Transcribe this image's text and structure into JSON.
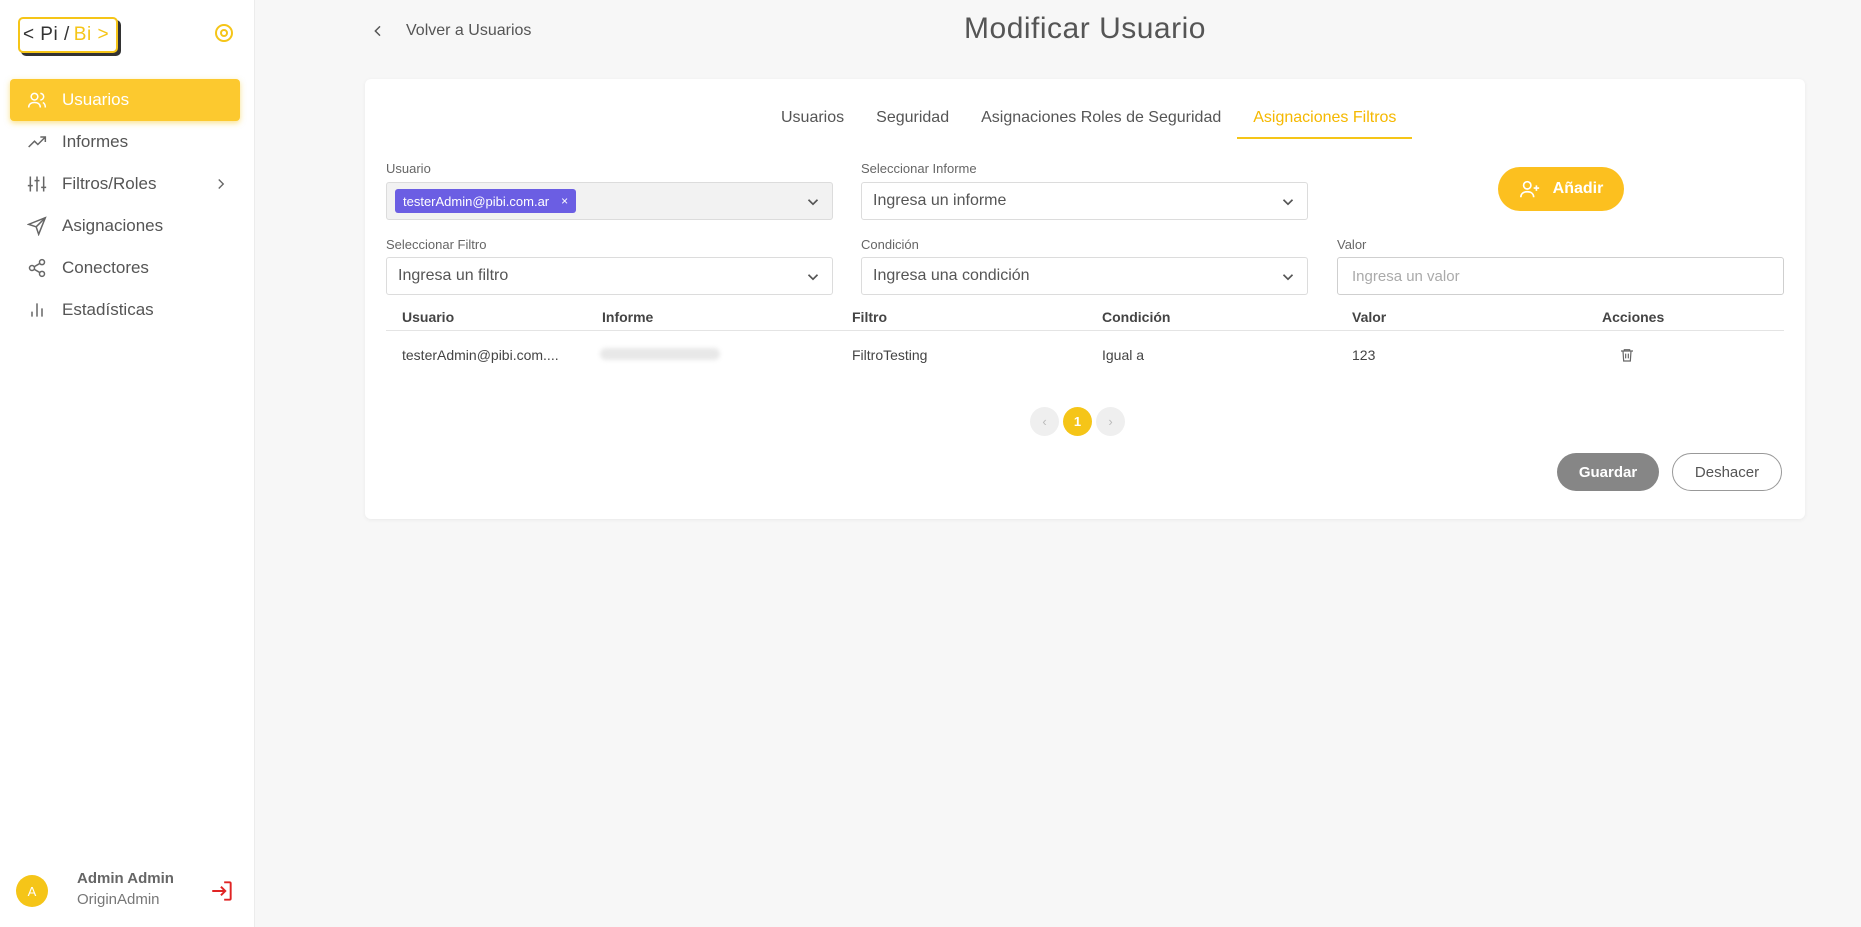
{
  "brand": {
    "logo_left": "< Pi /",
    "logo_right": "Bi >"
  },
  "sidebar": {
    "items": [
      {
        "label": "Usuarios",
        "icon": "users-icon",
        "active": true
      },
      {
        "label": "Informes",
        "icon": "trending-up-icon"
      },
      {
        "label": "Filtros/Roles",
        "icon": "sliders-icon",
        "has_submenu": true
      },
      {
        "label": "Asignaciones",
        "icon": "send-icon"
      },
      {
        "label": "Conectores",
        "icon": "share-icon"
      },
      {
        "label": "Estadísticas",
        "icon": "bar-chart-icon"
      }
    ]
  },
  "profile": {
    "initial": "A",
    "name": "Admin Admin",
    "role": "OriginAdmin"
  },
  "header": {
    "back_label": "Volver a Usuarios",
    "title": "Modificar Usuario"
  },
  "tabs": [
    "Usuarios",
    "Seguridad",
    "Asignaciones Roles de Seguridad",
    "Asignaciones Filtros"
  ],
  "active_tab": "Asignaciones Filtros",
  "form": {
    "usuario_label": "Usuario",
    "usuario_chip": "testerAdmin@pibi.com.ar",
    "chip_remove": "×",
    "informe_label": "Seleccionar Informe",
    "informe_placeholder": "Ingresa un informe",
    "filtro_label": "Seleccionar Filtro",
    "filtro_placeholder": "Ingresa un filtro",
    "condicion_label": "Condición",
    "condicion_placeholder": "Ingresa una condición",
    "valor_label": "Valor",
    "valor_placeholder": "Ingresa un valor",
    "add_label": "Añadir"
  },
  "table": {
    "headers": [
      "Usuario",
      "Informe",
      "Filtro",
      "Condición",
      "Valor",
      "Acciones"
    ],
    "rows": [
      {
        "usuario": "testerAdmin@pibi.com....",
        "informe": "",
        "filtro": "FiltroTesting",
        "condicion": "Igual a",
        "valor": "123"
      }
    ]
  },
  "pagination": {
    "prev": "‹",
    "current": "1",
    "next": "›"
  },
  "actions": {
    "save": "Guardar",
    "undo": "Deshacer"
  },
  "colors": {
    "accent": "#f5c518",
    "chip": "#6b5ee3",
    "save": "#868686",
    "logout": "#e02424"
  }
}
